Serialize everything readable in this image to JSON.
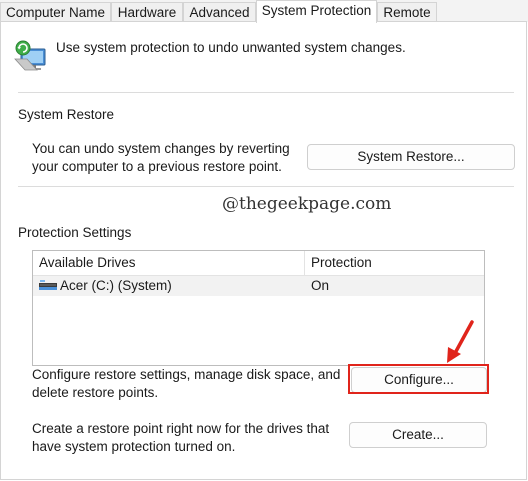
{
  "tabs": [
    {
      "label": "Computer Name",
      "active": false
    },
    {
      "label": "Hardware",
      "active": false
    },
    {
      "label": "Advanced",
      "active": false
    },
    {
      "label": "System Protection",
      "active": true
    },
    {
      "label": "Remote",
      "active": false
    }
  ],
  "intro": {
    "text": "Use system protection to undo unwanted system changes.",
    "icon": "system-protection-icon"
  },
  "system_restore": {
    "heading": "System Restore",
    "description": "You can undo system changes by reverting your computer to a previous restore point.",
    "button_label": "System Restore..."
  },
  "watermark": "@thegeekpage.com",
  "protection_settings": {
    "heading": "Protection Settings",
    "columns": [
      "Available Drives",
      "Protection"
    ],
    "drives": [
      {
        "name": "Acer (C:) (System)",
        "protection": "On",
        "icon": "drive-icon"
      }
    ]
  },
  "configure": {
    "description": "Configure restore settings, manage disk space, and delete restore points.",
    "button_label": "Configure..."
  },
  "create": {
    "description": "Create a restore point right now for the drives that have system protection turned on.",
    "button_label": "Create..."
  },
  "colors": {
    "highlight": "#e0241b",
    "row_selected": "#f2f2f2",
    "panel_border": "#d4d4d4"
  }
}
